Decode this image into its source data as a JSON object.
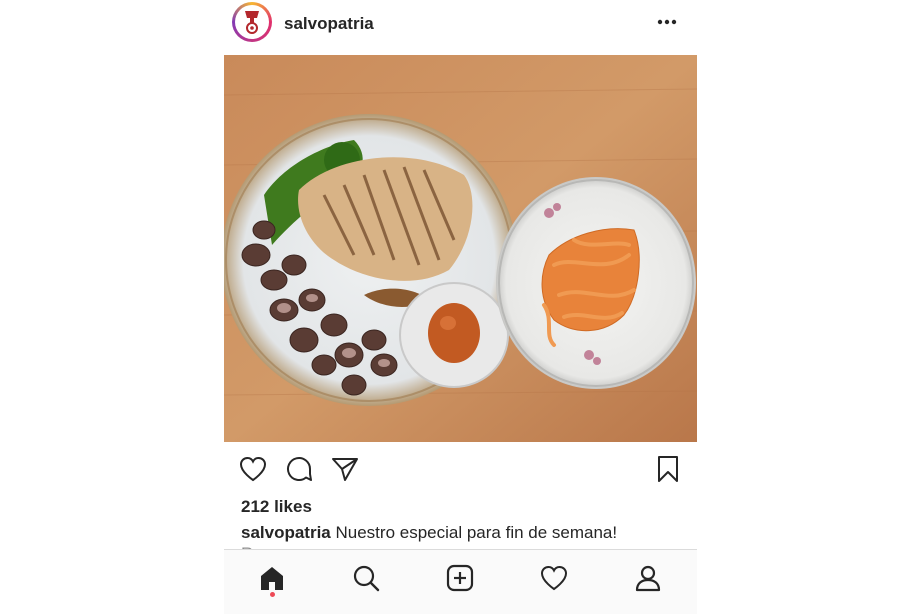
{
  "post": {
    "username": "salvopatria",
    "likes": "212 likes",
    "caption_user": "salvopatria",
    "caption_text": "Nuestro especial para fin de semana!",
    "caption_more": "Re..."
  },
  "icons": {
    "more": "more-horizontal-icon",
    "like": "heart-outline-icon",
    "comment": "comment-bubble-icon",
    "share": "paper-plane-icon",
    "save": "bookmark-icon",
    "tab_home": "home-icon",
    "tab_search": "search-icon",
    "tab_new": "new-post-icon",
    "tab_activity": "heart-icon",
    "tab_profile": "profile-icon"
  },
  "colors": {
    "accent_dot": "#ed4956",
    "table_wood": "#c98a5a",
    "avatar_logo": "#b3282d"
  }
}
